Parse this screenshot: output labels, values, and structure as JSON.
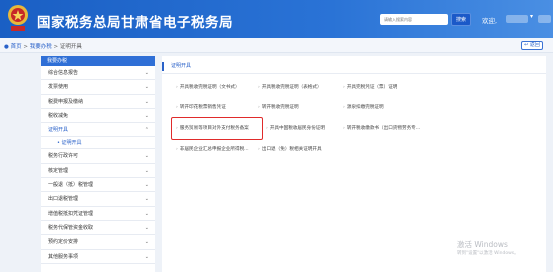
{
  "header": {
    "title": "国家税务总局甘肃省电子税务局",
    "search_placeholder": "请输入搜索内容",
    "search_button": "搜索",
    "welcome": "欢迎,"
  },
  "breadcrumb": {
    "home": "首页",
    "sep1": ">",
    "level2": "我要办税",
    "sep2": ">",
    "current": "证明开具",
    "back": "返回"
  },
  "sidebar": {
    "heading": "我要办税",
    "items": [
      {
        "label": "综合信息报告",
        "chev": "⌄"
      },
      {
        "label": "发票使用",
        "chev": "⌄"
      },
      {
        "label": "税费申报及缴纳",
        "chev": "⌄"
      },
      {
        "label": "税收减免",
        "chev": "⌄"
      },
      {
        "label": "证明开具",
        "chev": "⌃"
      },
      {
        "label": "证明开具",
        "chev": ""
      },
      {
        "label": "税务行政许可",
        "chev": "⌄"
      },
      {
        "label": "核定管理",
        "chev": "⌄"
      },
      {
        "label": "一般退（抵）税管理",
        "chev": "⌄"
      },
      {
        "label": "出口退税管理",
        "chev": "⌄"
      },
      {
        "label": "增值税抵扣凭证管理",
        "chev": "⌄"
      },
      {
        "label": "税务代保管资金收取",
        "chev": "⌄"
      },
      {
        "label": "预约定价安排",
        "chev": "⌄"
      },
      {
        "label": "其他服务事项",
        "chev": "⌄"
      }
    ]
  },
  "main": {
    "heading": "证明开具",
    "links": [
      "开具税收完税证明（文书式）",
      "开具税收完税证明（表格式）",
      "开具完税凭证（票）证明",
      "转开印花税票销售凭证",
      "转开税收完税证明",
      "源泉扣缴完税证明",
      "服务贸易等项目对外支付税务备案",
      "开具中国税收居民身份证明",
      "转开税收缴款书（出口货物劳务专...",
      "非居民企业汇总申报企业所得税...",
      "出口退（免）税相关证明开具"
    ]
  },
  "watermark": {
    "line1": "激活 Windows",
    "line2": "转到\"设置\"以激活 Windows。"
  }
}
